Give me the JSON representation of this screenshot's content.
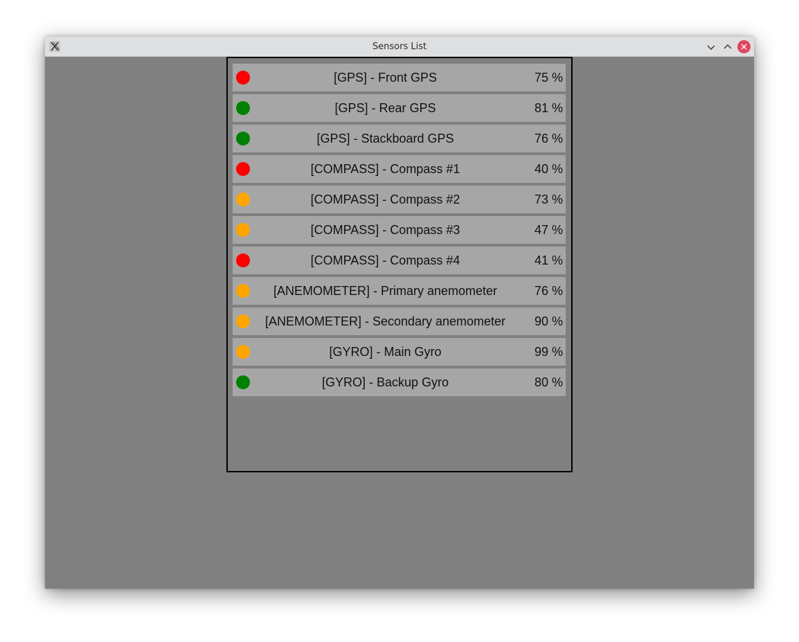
{
  "window": {
    "title": "Sensors List"
  },
  "colors": {
    "red": "#ff0000",
    "green": "#008000",
    "orange": "#ffa500",
    "row_bg": "#a6a6a6",
    "window_bg": "#808080"
  },
  "sensors": [
    {
      "label": "[GPS] - Front GPS",
      "percent": "75 %",
      "status": "red"
    },
    {
      "label": "[GPS] - Rear GPS",
      "percent": "81 %",
      "status": "green"
    },
    {
      "label": "[GPS] - Stackboard GPS",
      "percent": "76 %",
      "status": "green"
    },
    {
      "label": "[COMPASS] - Compass #1",
      "percent": "40 %",
      "status": "red"
    },
    {
      "label": "[COMPASS] - Compass #2",
      "percent": "73 %",
      "status": "orange"
    },
    {
      "label": "[COMPASS] - Compass #3",
      "percent": "47 %",
      "status": "orange"
    },
    {
      "label": "[COMPASS] - Compass #4",
      "percent": "41 %",
      "status": "red"
    },
    {
      "label": "[ANEMOMETER] - Primary anemometer",
      "percent": "76 %",
      "status": "orange"
    },
    {
      "label": "[ANEMOMETER] - Secondary anemometer",
      "percent": "90 %",
      "status": "orange"
    },
    {
      "label": "[GYRO] - Main Gyro",
      "percent": "99 %",
      "status": "orange"
    },
    {
      "label": "[GYRO] - Backup Gyro",
      "percent": "80 %",
      "status": "green"
    }
  ]
}
